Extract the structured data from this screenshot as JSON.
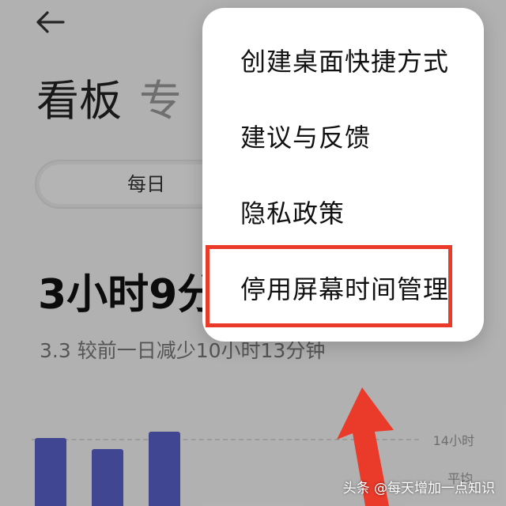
{
  "header": {
    "back_icon": "arrow-left-icon"
  },
  "title": {
    "primary": "看板",
    "secondary": "专"
  },
  "segment": {
    "selected_label": "每日"
  },
  "summary": {
    "total_time": "3小时9分",
    "compare_text": "3.3 较前一日减少10小时13分钟"
  },
  "chart": {
    "max_label": "14小时",
    "avg_label": "平均",
    "bar_color": "#5a62cc"
  },
  "chart_data": {
    "type": "bar",
    "y_max_label": "14小时",
    "reference_label": "平均",
    "values_fraction": [
      0.66,
      0.55,
      0.72
    ]
  },
  "menu": {
    "items": [
      {
        "label": "创建桌面快捷方式"
      },
      {
        "label": "建议与反馈"
      },
      {
        "label": "隐私政策"
      },
      {
        "label": "停用屏幕时间管理",
        "highlighted": true
      }
    ]
  },
  "annotation": {
    "color": "#e93a2a"
  },
  "watermark": {
    "text": "头条 @每天增加一点知识"
  }
}
